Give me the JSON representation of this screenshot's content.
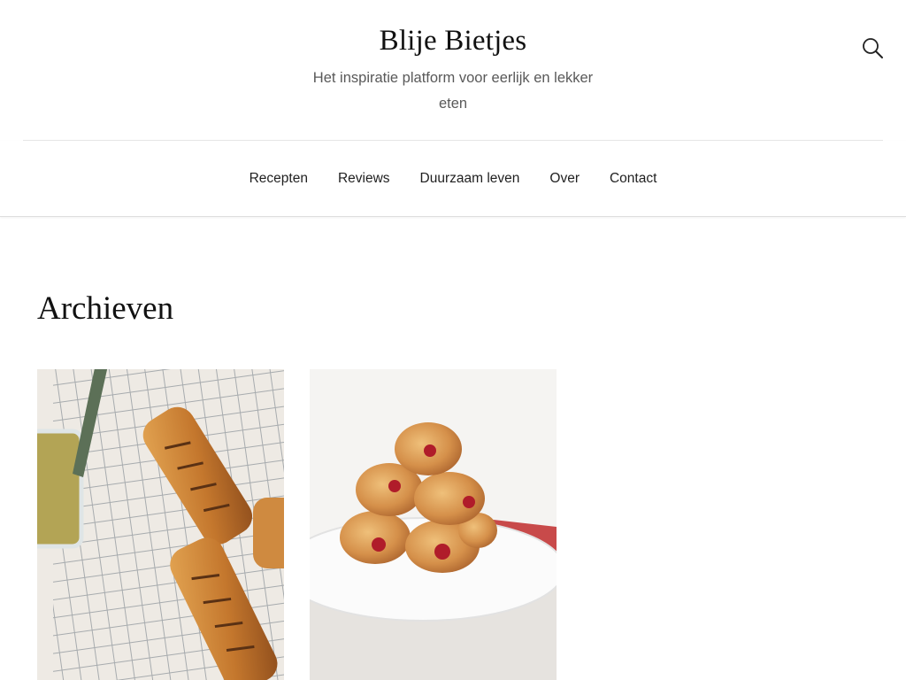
{
  "site": {
    "title": "Blije Bietjes",
    "tagline": "Het inspiratie platform voor eerlijk en lekker eten"
  },
  "icons": {
    "search": "search-icon"
  },
  "nav": {
    "items": [
      {
        "label": "Recepten"
      },
      {
        "label": "Reviews"
      },
      {
        "label": "Duurzaam leven"
      },
      {
        "label": "Over"
      },
      {
        "label": "Contact"
      }
    ]
  },
  "archive": {
    "title": "Archieven"
  },
  "colors": {
    "text": "#111111",
    "tagline": "#595959",
    "divider": "#e6e6e6"
  }
}
